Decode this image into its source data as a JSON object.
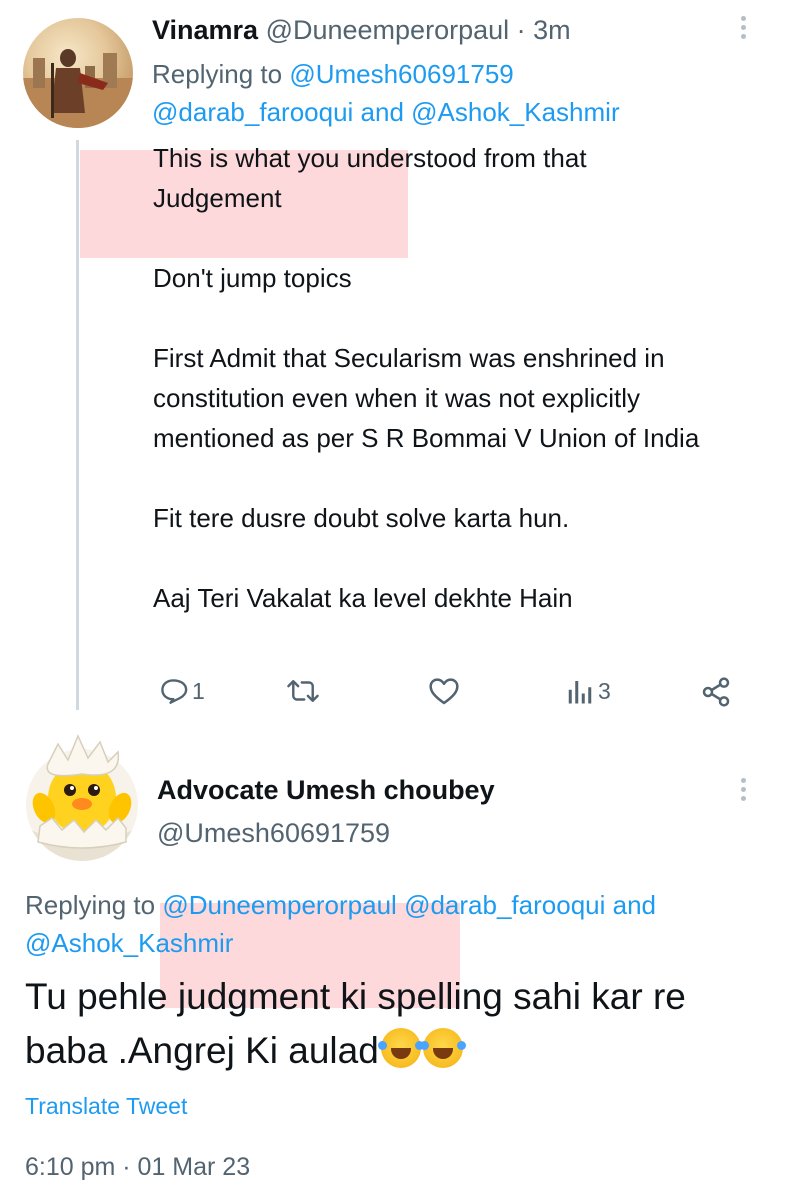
{
  "tweet1": {
    "display_name": "Vinamra",
    "handle": "@Duneemperorpaul",
    "time": " · 3m",
    "replying_prefix": "Replying to ",
    "replying_to_1": "@Umesh60691759",
    "replying_to_2": "@darab_farooqui",
    "replying_and": " and ",
    "replying_to_3": "@Ashok_Kashmir",
    "body": [
      "This is what you understood from that Judgement",
      "Don't jump topics",
      "First Admit that Secularism was enshrined in constitution even when it was not explicitly mentioned as per S R Bommai V Union of India",
      "Fit tere dusre doubt solve karta hun.",
      "Aaj Teri Vakalat ka level dekhte Hain"
    ],
    "actions": {
      "reply_count": "1",
      "retweet_count": "",
      "like_count": "",
      "views_count": "3"
    }
  },
  "tweet2": {
    "display_name": "Advocate Umesh choubey",
    "handle": "@Umesh60691759",
    "replying_prefix": "Replying to ",
    "replying_to_1": "@Duneemperorpaul",
    "replying_to_2": "@darab_farooqui",
    "replying_and": " and",
    "replying_to_3": "@Ashok_Kashmir",
    "body": "Tu pehle judgment ki spelling sahi kar re baba .Angrej Ki aulad",
    "translate_label": "Translate Tweet",
    "timestamp": "6:10 pm · 01 Mar 23"
  },
  "colors": {
    "accent": "#1d9bf0",
    "secondary_text": "#536471",
    "highlight": "#f9aab0"
  },
  "icons": [
    "reply-icon",
    "retweet-icon",
    "like-icon",
    "views-icon",
    "share-icon",
    "more-icon",
    "rolling-laughing-emoji"
  ]
}
